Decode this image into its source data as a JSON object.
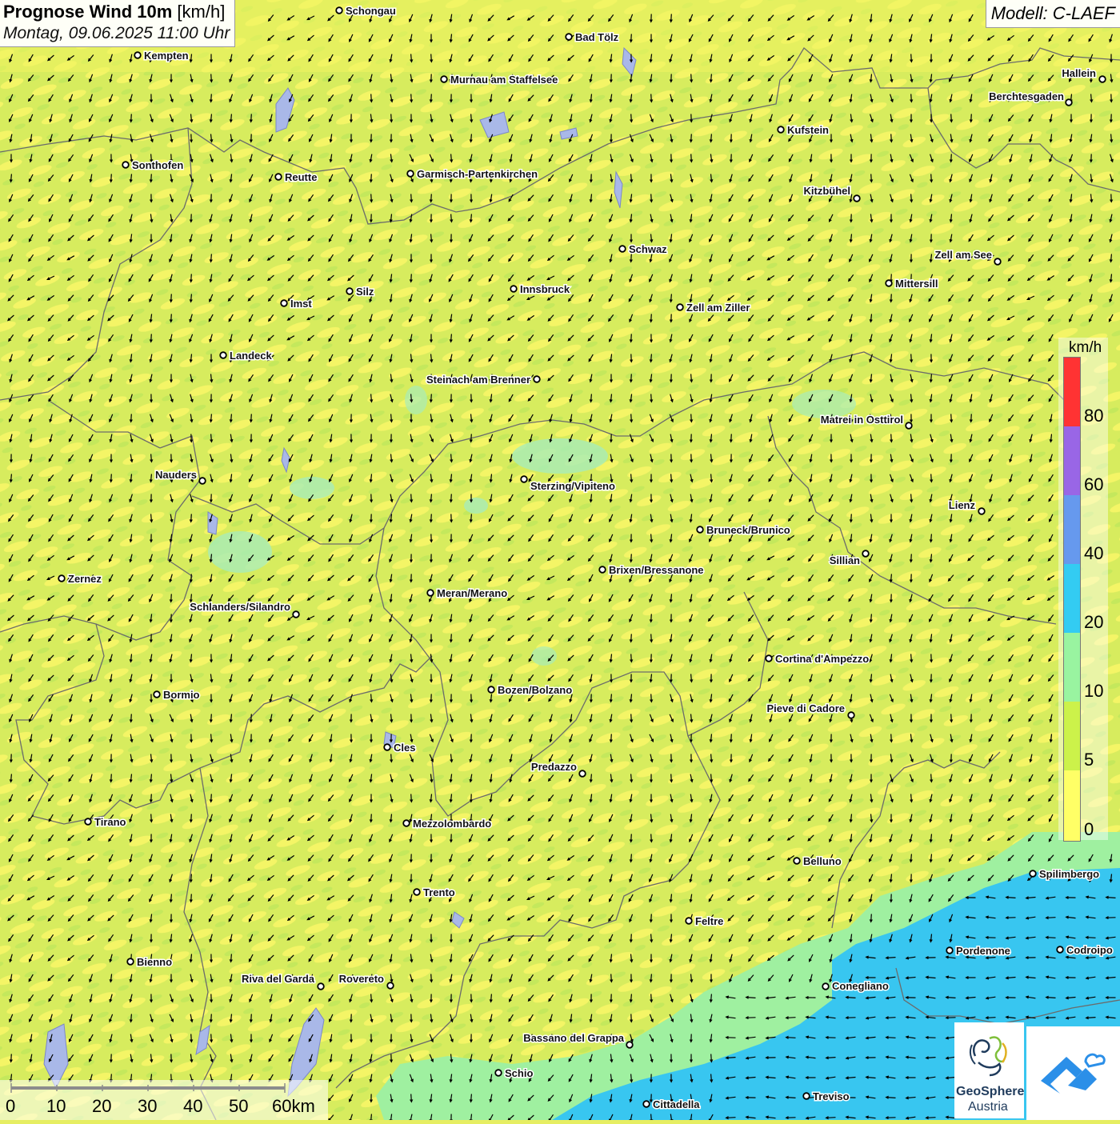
{
  "header": {
    "title_bold": "Prognose Wind 10m",
    "title_unit": "[km/h]",
    "subtitle": "Montag, 09.06.2025 11:00 Uhr"
  },
  "model_label": "Modell: C-LAEF",
  "legend": {
    "unit": "km/h",
    "levels": [
      {
        "label": "0",
        "color": "#ffff66"
      },
      {
        "label": "5",
        "color": "#ccf24a"
      },
      {
        "label": "10",
        "color": "#99f4a0"
      },
      {
        "label": "20",
        "color": "#33ccf2"
      },
      {
        "label": "40",
        "color": "#6699ee"
      },
      {
        "label": "60",
        "color": "#9966e6"
      },
      {
        "label": "80",
        "color": "#ff3333"
      }
    ]
  },
  "scale_bar": {
    "labels": [
      "0",
      "10",
      "20",
      "30",
      "40",
      "50",
      "60km"
    ]
  },
  "logos": {
    "geosphere_line1": "GeoSphere",
    "geosphere_line2": "Austria",
    "geosphere_icon": "geosphere-logo-icon",
    "app_icon": "wind-app-logo-icon"
  },
  "cities": [
    {
      "name": "Schongau"
    },
    {
      "name": "Bad Tölz"
    },
    {
      "name": "Kempten"
    },
    {
      "name": "Murnau am Staffelsee"
    },
    {
      "name": "Hallein"
    },
    {
      "name": "Berchtesgaden"
    },
    {
      "name": "Kufstein"
    },
    {
      "name": "Sonthofen"
    },
    {
      "name": "Reutte"
    },
    {
      "name": "Garmisch-Partenkirchen"
    },
    {
      "name": "Kitzbühel"
    },
    {
      "name": "Schwaz"
    },
    {
      "name": "Zell am See"
    },
    {
      "name": "Mittersill"
    },
    {
      "name": "Innsbruck"
    },
    {
      "name": "Silz"
    },
    {
      "name": "Imst"
    },
    {
      "name": "Zell am Ziller"
    },
    {
      "name": "Landeck"
    },
    {
      "name": "Steinach am Brenner"
    },
    {
      "name": "Matrei in Osttirol"
    },
    {
      "name": "Nauders"
    },
    {
      "name": "Sterzing/Vipiteno"
    },
    {
      "name": "Lienz"
    },
    {
      "name": "Bruneck/Brunico"
    },
    {
      "name": "Sillian"
    },
    {
      "name": "Zernez"
    },
    {
      "name": "Brixen/Bressanone"
    },
    {
      "name": "Meran/Merano"
    },
    {
      "name": "Schlanders/Silandro"
    },
    {
      "name": "Cortina d'Ampezzo"
    },
    {
      "name": "Bormio"
    },
    {
      "name": "Bozen/Bolzano"
    },
    {
      "name": "Pieve di Cadore"
    },
    {
      "name": "Cles"
    },
    {
      "name": "Predazzo"
    },
    {
      "name": "Tirano"
    },
    {
      "name": "Mezzolombardo"
    },
    {
      "name": "Belluno"
    },
    {
      "name": "Spilimbergo"
    },
    {
      "name": "Trento"
    },
    {
      "name": "Feltre"
    },
    {
      "name": "Bienno"
    },
    {
      "name": "Pordenone"
    },
    {
      "name": "Codroipo"
    },
    {
      "name": "Riva del Garda"
    },
    {
      "name": "Rovereto"
    },
    {
      "name": "Conegliano"
    },
    {
      "name": "Bassano del Grappa"
    },
    {
      "name": "Schio"
    },
    {
      "name": "Treviso"
    },
    {
      "name": "Cittadella"
    }
  ]
}
